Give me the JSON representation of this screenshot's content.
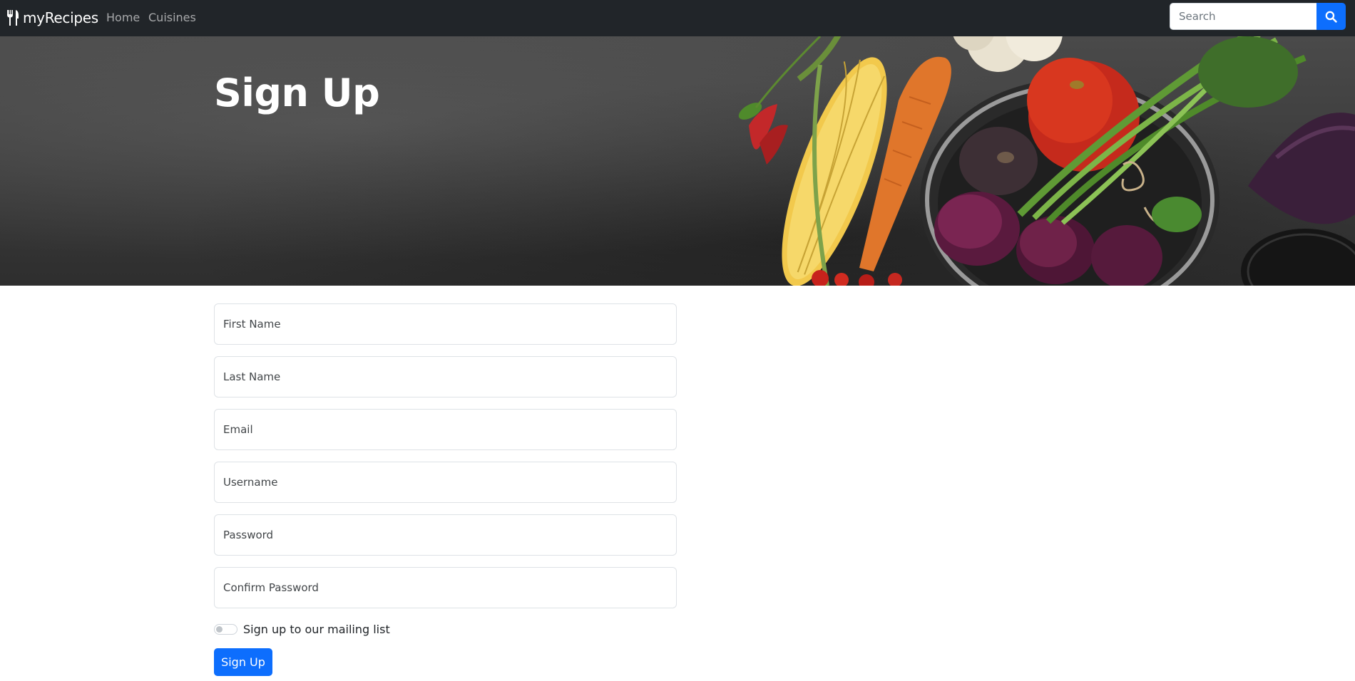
{
  "navbar": {
    "brand": "myRecipes",
    "brand_icon": "utensils-icon",
    "links": [
      {
        "label": "Home"
      },
      {
        "label": "Cuisines"
      }
    ],
    "search": {
      "placeholder": "Search",
      "value": "",
      "button_icon": "search-icon"
    },
    "background": "#212529"
  },
  "hero": {
    "title": "Sign Up",
    "background_image": "vegetables-on-slate"
  },
  "form": {
    "fields": [
      {
        "placeholder": "First Name",
        "value": ""
      },
      {
        "placeholder": "Last Name",
        "value": ""
      },
      {
        "placeholder": "Email",
        "value": ""
      },
      {
        "placeholder": "Username",
        "value": ""
      },
      {
        "placeholder": "Password",
        "value": ""
      },
      {
        "placeholder": "Confirm Password",
        "value": ""
      }
    ],
    "mailing_list": {
      "label": "Sign up to our mailing list",
      "checked": false
    },
    "submit_label": "Sign Up"
  },
  "colors": {
    "accent": "#0d6efd",
    "navbar": "#212529"
  }
}
